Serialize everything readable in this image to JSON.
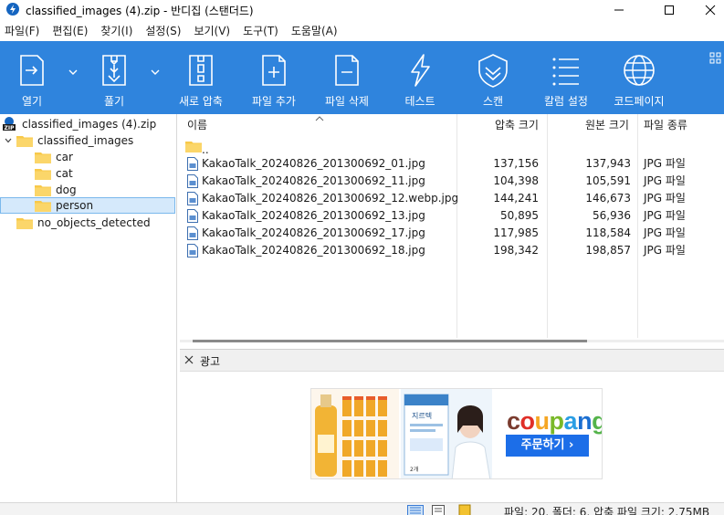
{
  "window": {
    "title": "classified_images (4).zip - 반디집 (스탠더드)",
    "minimize_glyph": "—",
    "maximize_glyph": "☐",
    "close_glyph": "✕"
  },
  "menu": [
    "파일(F)",
    "편집(E)",
    "찾기(I)",
    "설정(S)",
    "보기(V)",
    "도구(T)",
    "도움말(A)"
  ],
  "toolbar": {
    "background": "#2f84dd",
    "buttons": [
      {
        "label": "열기",
        "icon": "open-archive-icon"
      },
      {
        "label": "풀기",
        "icon": "extract-icon"
      },
      {
        "label": "새로 압축",
        "icon": "new-archive-icon"
      },
      {
        "label": "파일 추가",
        "icon": "add-file-icon"
      },
      {
        "label": "파일 삭제",
        "icon": "delete-file-icon"
      },
      {
        "label": "테스트",
        "icon": "test-lightning-icon"
      },
      {
        "label": "스캔",
        "icon": "scan-shield-icon"
      },
      {
        "label": "칼럼 설정",
        "icon": "column-settings-icon"
      },
      {
        "label": "코드페이지",
        "icon": "codepage-globe-icon"
      }
    ]
  },
  "tree": {
    "root": "classified_images (4).zip",
    "items": [
      {
        "label": "classified_images",
        "expanded": true
      },
      {
        "label": "car"
      },
      {
        "label": "cat"
      },
      {
        "label": "dog"
      },
      {
        "label": "person",
        "selected": true
      },
      {
        "label": "no_objects_detected"
      }
    ]
  },
  "filelist": {
    "columns": [
      "이름",
      "압축 크기",
      "원본 크기",
      "파일 종류"
    ],
    "parent_entry": "..",
    "rows": [
      {
        "name": "KakaoTalk_20240826_201300692_01.jpg",
        "packed": "137,156",
        "original": "137,943",
        "type": "JPG 파일"
      },
      {
        "name": "KakaoTalk_20240826_201300692_11.jpg",
        "packed": "104,398",
        "original": "105,591",
        "type": "JPG 파일"
      },
      {
        "name": "KakaoTalk_20240826_201300692_12.webp.jpg",
        "packed": "144,241",
        "original": "146,673",
        "type": "JPG 파일"
      },
      {
        "name": "KakaoTalk_20240826_201300692_13.jpg",
        "packed": "50,895",
        "original": "56,936",
        "type": "JPG 파일"
      },
      {
        "name": "KakaoTalk_20240826_201300692_17.jpg",
        "packed": "117,985",
        "original": "118,584",
        "type": "JPG 파일"
      },
      {
        "name": "KakaoTalk_20240826_201300692_18.jpg",
        "packed": "198,342",
        "original": "198,857",
        "type": "JPG 파일"
      }
    ]
  },
  "ad": {
    "title": "광고",
    "brand": [
      "c",
      "o",
      "u",
      "p",
      "a",
      "n",
      "g"
    ],
    "brand_colors": [
      "#7a3b2e",
      "#e02f28",
      "#f5a623",
      "#7ab929",
      "#2a9ee4",
      "#1b6fd1",
      "#55b44b"
    ],
    "cta": "주문하기 ›",
    "product2_name": "지르텍",
    "product2_badge": "2개"
  },
  "status": {
    "text": "파일: 20, 폴더: 6, 압축 파일 크기: 2.75MB"
  }
}
